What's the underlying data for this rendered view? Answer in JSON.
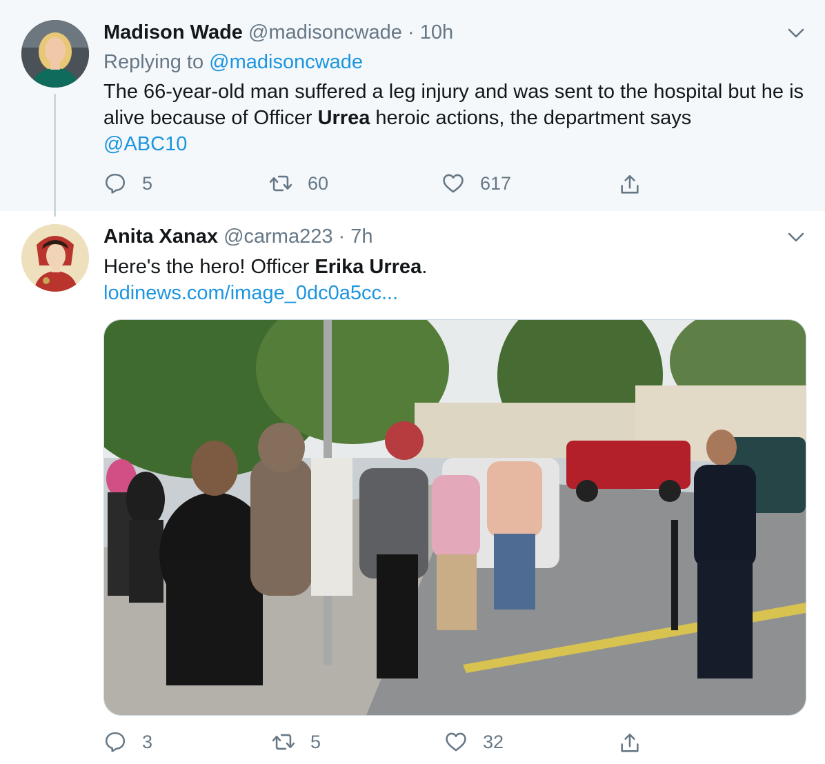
{
  "tweet1": {
    "name": "Madison Wade",
    "handle": "@madisoncwade",
    "separator": "·",
    "time": "10h",
    "replying_label": "Replying to",
    "replying_handle": "@madisoncwade",
    "text_part1": "The 66-year-old man suffered a leg injury and was sent to the hospital but he is alive because of Officer ",
    "text_bold": "Urrea",
    "text_part2": " heroic actions, the department says",
    "mention": "@ABC10",
    "replies": "5",
    "retweets": "60",
    "likes": "617"
  },
  "tweet2": {
    "name": "Anita Xanax",
    "handle": "@carma223",
    "separator": "·",
    "time": "7h",
    "text_part1": "Here's the hero! Officer ",
    "text_bold": "Erika Urrea",
    "text_part2": ".",
    "link": "lodinews.com/image_0dc0a5cc...",
    "replies": "3",
    "retweets": "5",
    "likes": "32"
  },
  "colors": {
    "accent": "#1b95e0",
    "muted": "#657786",
    "highlight_bg": "#f5f8fa"
  },
  "icons": [
    "chevron-down-icon",
    "reply-icon",
    "retweet-icon",
    "like-icon",
    "share-icon"
  ]
}
